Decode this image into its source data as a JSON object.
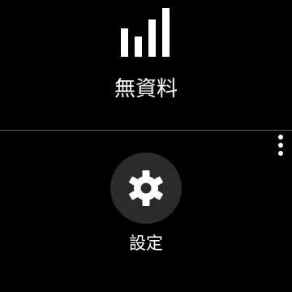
{
  "plan": {
    "title": "無資料",
    "icon": "signal-strength-icon",
    "signal_bar_count": 4
  },
  "menu": {
    "icon": "more-vertical-icon"
  },
  "settings": {
    "label": "設定",
    "icon": "gear-icon"
  },
  "colors": {
    "background": "#000000",
    "text": "#ffffff",
    "divider": "#5f5f5f",
    "button_background": "#2b2b2b"
  }
}
